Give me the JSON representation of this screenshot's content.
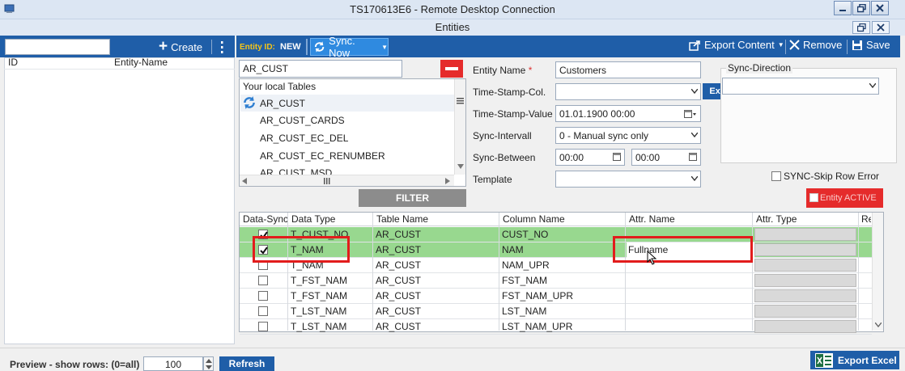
{
  "window": {
    "title": "TS170613E6 - Remote Desktop Connection"
  },
  "app": {
    "title": "Entities"
  },
  "left_panel": {
    "search_value": "",
    "create_label": "Create",
    "columns": [
      "ID",
      "Entity-Name"
    ]
  },
  "toolbar": {
    "entity_id_label": "Entity ID:",
    "entity_id_value": "NEW",
    "sync_now_label": "Sync. Now",
    "export_content_label": "Export Content",
    "remove_label": "Remove",
    "save_label": "Save"
  },
  "table_picker": {
    "search_value": "AR_CUST",
    "header": "Your local Tables",
    "items": [
      "AR_CUST",
      "AR_CUST_CARDS",
      "AR_CUST_EC_DEL",
      "AR_CUST_EC_RENUMBER",
      "AR_CUST_MSD"
    ],
    "filter_label": "FILTER"
  },
  "form": {
    "entity_name_label": "Entity Name",
    "entity_name_required": "*",
    "entity_name_value": "Customers",
    "timestamp_col_label": "Time-Stamp-Col.",
    "timestamp_col_value": "",
    "ext_label": "Ext.",
    "timestamp_value_label": "Time-Stamp-Value",
    "timestamp_value": "01.01.1900 00:00",
    "sync_interval_label": "Sync-Intervall",
    "sync_interval_value": "0 - Manual sync only",
    "sync_between_label": "Sync-Between",
    "sync_between_from": "00:00",
    "sync_between_to": "00:00",
    "template_label": "Template",
    "template_value": ""
  },
  "sync_direction": {
    "label": "Sync-Direction",
    "value": "",
    "skip_row_error_label": "SYNC-Skip Row Error",
    "skip_row_error_checked": false,
    "entity_active_label": "Entity ACTIVE",
    "entity_active_checked": false,
    "entity_active_color": "#e52b2b"
  },
  "grid": {
    "columns": [
      "Data-Sync",
      "Data Type",
      "Table Name",
      "Column Name",
      "Attr. Name",
      "Attr. Type",
      "Re"
    ],
    "rows": [
      {
        "sync": true,
        "data_type": "T_CUST_NO",
        "table": "AR_CUST",
        "column": "CUST_NO",
        "attr_name": "",
        "highlight": true
      },
      {
        "sync": true,
        "data_type": "T_NAM",
        "table": "AR_CUST",
        "column": "NAM",
        "attr_name": "Fullname",
        "highlight": true
      },
      {
        "sync": false,
        "data_type": "T_NAM",
        "table": "AR_CUST",
        "column": "NAM_UPR",
        "attr_name": "",
        "highlight": false
      },
      {
        "sync": false,
        "data_type": "T_FST_NAM",
        "table": "AR_CUST",
        "column": "FST_NAM",
        "attr_name": "",
        "highlight": false
      },
      {
        "sync": false,
        "data_type": "T_FST_NAM",
        "table": "AR_CUST",
        "column": "FST_NAM_UPR",
        "attr_name": "",
        "highlight": false
      },
      {
        "sync": false,
        "data_type": "T_LST_NAM",
        "table": "AR_CUST",
        "column": "LST_NAM",
        "attr_name": "",
        "highlight": false
      },
      {
        "sync": false,
        "data_type": "T_LST_NAM",
        "table": "AR_CUST",
        "column": "LST_NAM_UPR",
        "attr_name": "",
        "highlight": false
      }
    ],
    "row_highlight_color": "#98d88f",
    "annotation_color": "#e21c1c"
  },
  "bottom": {
    "preview_label": "Preview - show rows: (0=all)",
    "rows_value": "100",
    "refresh_label": "Refresh",
    "export_excel_label": "Export Excel"
  },
  "colors": {
    "toolbar_blue": "#1f5ea8",
    "sync_button_blue": "#2f8ae0",
    "danger_red": "#e52b2b"
  }
}
